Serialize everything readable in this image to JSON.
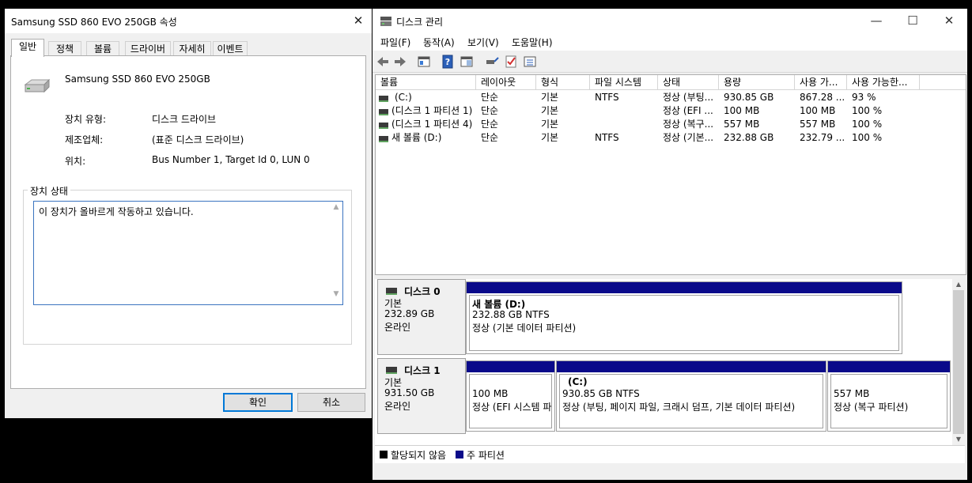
{
  "properties_dialog": {
    "title": "Samsung SSD 860 EVO 250GB 속성",
    "close_glyph": "✕",
    "tabs": [
      {
        "label": "일반",
        "active": true
      },
      {
        "label": "정책"
      },
      {
        "label": "볼륨"
      },
      {
        "label": "드라이버"
      },
      {
        "label": "자세히"
      },
      {
        "label": "이벤트"
      }
    ],
    "device_name": "Samsung SSD 860 EVO 250GB",
    "device_icon": "drive-icon",
    "properties": [
      {
        "label": "장치 유형:",
        "value": "디스크 드라이브"
      },
      {
        "label": "제조업체:",
        "value": "(표준 디스크 드라이브)"
      },
      {
        "label": "위치:",
        "value": "Bus Number 1, Target Id 0, LUN 0"
      }
    ],
    "status_group_label": "장치 상태",
    "status_text": "이 장치가 올바르게 작동하고 있습니다.",
    "ok_label": "확인",
    "cancel_label": "취소"
  },
  "disk_management": {
    "title": "디스크 관리",
    "controls": {
      "minimize": "—",
      "maximize": "☐",
      "close": "✕"
    },
    "menu": [
      "파일(F)",
      "동작(A)",
      "보기(V)",
      "도움말(H)"
    ],
    "toolbar_icons": [
      "back-arrow-icon",
      "forward-arrow-icon",
      "properties-icon",
      "help-icon",
      "panel-icon",
      "connect-icon",
      "check-icon",
      "list-icon"
    ],
    "columns": [
      "볼륨",
      "레이아웃",
      "형식",
      "파일 시스템",
      "상태",
      "용량",
      "사용 가...",
      "사용 가능한..."
    ],
    "volumes": [
      [
        "(C:)",
        "단순",
        "기본",
        "NTFS",
        "정상 (부팅...",
        "930.85 GB",
        "867.28 ...",
        "93 %"
      ],
      [
        "(디스크 1 파티션 1)",
        "단순",
        "기본",
        "",
        "정상 (EFI ...",
        "100 MB",
        "100 MB",
        "100 %"
      ],
      [
        "(디스크 1 파티션 4)",
        "단순",
        "기본",
        "",
        "정상 (복구...",
        "557 MB",
        "557 MB",
        "100 %"
      ],
      [
        "새 볼륨 (D:)",
        "단순",
        "기본",
        "NTFS",
        "정상 (기본...",
        "232.88 GB",
        "232.79 ...",
        "100 %"
      ]
    ],
    "disks": [
      {
        "name": "디스크 0",
        "type": "기본",
        "size": "232.89 GB",
        "status": "온라인",
        "partitions": [
          {
            "title": "새 볼륨  (D:)",
            "line1": "232.88 GB NTFS",
            "line2": "정상 (기본 데이터 파티션)"
          }
        ]
      },
      {
        "name": "디스크 1",
        "type": "기본",
        "size": "931.50 GB",
        "status": "온라인",
        "partitions": [
          {
            "title": "",
            "line1": "100 MB",
            "line2": "정상 (EFI 시스템 파"
          },
          {
            "title": "(C:)",
            "line1": "930.85 GB NTFS",
            "line2": "정상 (부팅, 페이지 파일, 크래시 덤프, 기본 데이터 파티션)"
          },
          {
            "title": "",
            "line1": "557 MB",
            "line2": "정상 (복구 파티션)"
          }
        ]
      }
    ],
    "legend": [
      {
        "label": "할당되지 않음",
        "color": "#000000"
      },
      {
        "label": "주 파티션",
        "color": "#0a0a8a"
      }
    ]
  }
}
